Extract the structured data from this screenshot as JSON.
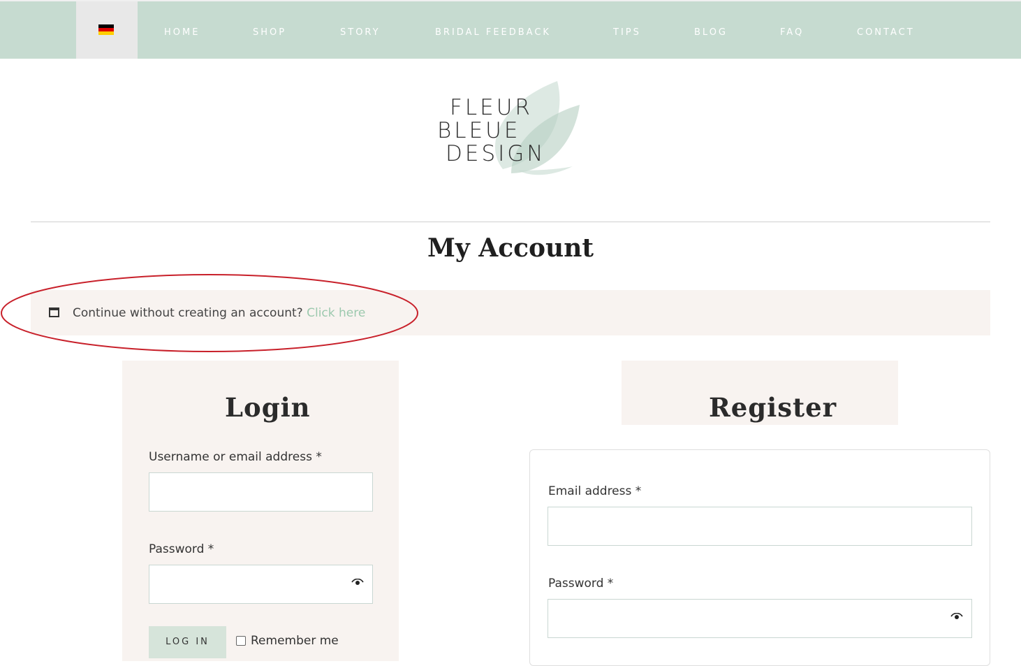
{
  "nav": {
    "language_flag": "germany-flag-icon",
    "items": [
      "HOME",
      "SHOP",
      "STORY",
      "BRIDAL FEEDBACK",
      "TIPS",
      "BLOG",
      "FAQ",
      "CONTACT"
    ]
  },
  "logo": {
    "line1": "FLEUR",
    "line2": "BLEUE",
    "line3": "DESIGN"
  },
  "page": {
    "title": "My Account"
  },
  "notice": {
    "icon": "window-icon",
    "text": "Continue without creating an account?",
    "link": "Click here"
  },
  "login": {
    "title": "Login",
    "username_label": "Username or email address *",
    "username_value": "",
    "password_label": "Password *",
    "password_value": "",
    "submit": "LOG IN",
    "remember": "Remember me"
  },
  "register": {
    "title": "Register",
    "email_label": "Email address *",
    "email_value": "",
    "password_label": "Password *",
    "password_value": ""
  },
  "colors": {
    "nav_bg": "#c6dbd0",
    "panel_bg": "#f8f3f0",
    "link": "#9cc9ae",
    "highlight": "#c8202a"
  }
}
